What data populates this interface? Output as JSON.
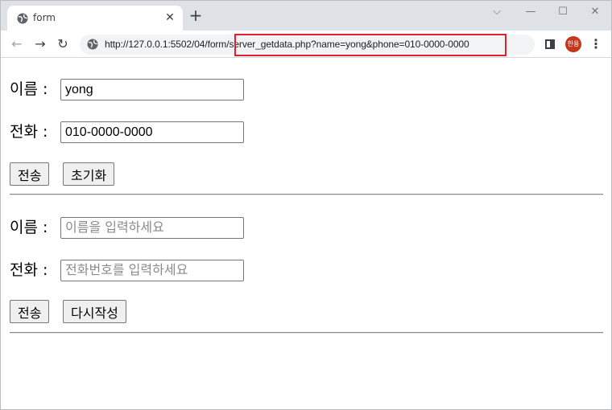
{
  "browser": {
    "tab_title": "form",
    "url_prefix": "http://127.0.0.1:5502/04/form",
    "url_highlighted": "/server_getdata.php?name=yong&phone=010-0000-0000",
    "profile_label": "한용",
    "highlight_color": "#e0202a"
  },
  "form1": {
    "name_label": "이름 :",
    "name_value": "yong",
    "phone_label": "전화 :",
    "phone_value": "010-0000-0000",
    "submit_label": "전송",
    "reset_label": "초기화"
  },
  "form2": {
    "name_label": "이름 :",
    "name_placeholder": "이름을 입력하세요",
    "phone_label": "전화 :",
    "phone_placeholder": "전화번호를 입력하세요",
    "submit_label": "전송",
    "reset_label": "다시작성"
  },
  "icons": [
    "globe-icon",
    "close-icon",
    "plus-icon",
    "back-icon",
    "forward-icon",
    "reload-icon",
    "info-icon",
    "side-panel-icon",
    "menu-icon"
  ]
}
